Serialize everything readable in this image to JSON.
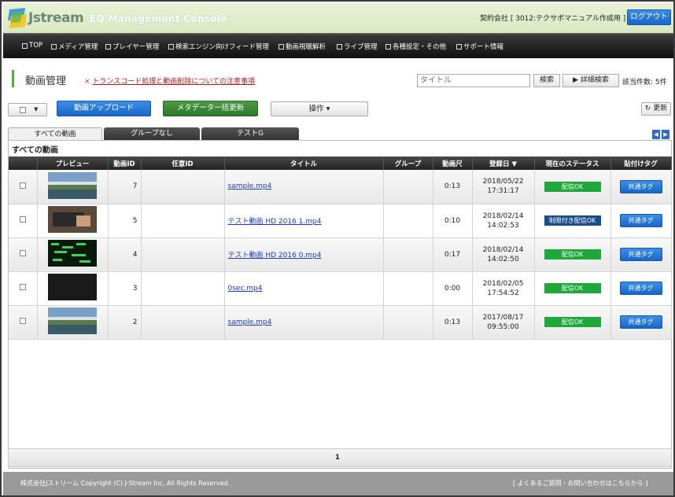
{
  "header": {
    "logo_text": "Jstream",
    "console_title": "EQ Management Console",
    "company": "契約会社 [ 3012:テクサポマニュアル作成用 ]",
    "logout_label": "ログアウト"
  },
  "nav": {
    "items": [
      {
        "label": "TOP"
      },
      {
        "label": "メディア管理"
      },
      {
        "label": "プレイヤー管理"
      },
      {
        "label": "検索エンジン向けフィード管理"
      },
      {
        "label": "動画視聴解析"
      },
      {
        "label": "ライブ管理"
      },
      {
        "label": "各種設定・その他"
      },
      {
        "label": "サポート情報"
      }
    ]
  },
  "page": {
    "title": "動画管理",
    "notice_mark": "×",
    "notice_link": "トランスコード処理と動画削除についての注意事項",
    "search_placeholder": "タイトル",
    "search_button": "検索",
    "advanced_search": "▶ 詳細検索",
    "count": "該当件数: 5件"
  },
  "toolbar": {
    "select_arrow": "▼",
    "upload_label": "動画アップロード",
    "metadata_label": "メタデータ一括更新",
    "operations_label": "操作 ▾",
    "refresh_label": "↻ 更新"
  },
  "tabs": [
    {
      "label": "すべての動画"
    },
    {
      "label": "グループなし"
    },
    {
      "label": "テストG"
    }
  ],
  "tab_arrows": {
    "prev": "◀",
    "next": "▶"
  },
  "list": {
    "title": "すべての動画",
    "columns": [
      "",
      "プレビュー",
      "動画ID",
      "任意ID",
      "タイトル",
      "グループ",
      "動画尺",
      "登録日 ▼",
      "現在のステータス",
      "貼付けタグ"
    ],
    "rows": [
      {
        "id": "7",
        "custom_id": "",
        "title": "sample.mp4",
        "group": "",
        "duration": "0:13",
        "date": "2018/05/22",
        "time": "17:31:17",
        "status": "配信OK",
        "status_kind": "ok",
        "tag": "共通タグ",
        "thumb": "coast"
      },
      {
        "id": "5",
        "custom_id": "",
        "title": "テスト動画 HD 2016 1.mp4",
        "group": "",
        "duration": "0:10",
        "date": "2018/02/14",
        "time": "14:02:53",
        "status": "制限付き配信OK",
        "status_kind": "limited",
        "tag": "共通タグ",
        "thumb": "keyboard"
      },
      {
        "id": "4",
        "custom_id": "",
        "title": "テスト動画 HD 2016 0.mp4",
        "group": "",
        "duration": "0:17",
        "date": "2018/02/14",
        "time": "14:02:50",
        "status": "配信OK",
        "status_kind": "ok",
        "tag": "共通タグ",
        "thumb": "matrix"
      },
      {
        "id": "3",
        "custom_id": "",
        "title": "0sec.mp4",
        "group": "",
        "duration": "0:00",
        "date": "2018/02/05",
        "time": "17:54:52",
        "status": "配信OK",
        "status_kind": "ok",
        "tag": "共通タグ",
        "thumb": "black"
      },
      {
        "id": "2",
        "custom_id": "",
        "title": "sample.mp4",
        "group": "",
        "duration": "0:13",
        "date": "2017/08/17",
        "time": "09:55:00",
        "status": "配信OK",
        "status_kind": "ok",
        "tag": "共通タグ",
        "thumb": "coast"
      }
    ]
  },
  "pagination": {
    "current": "1"
  },
  "footer": {
    "copyright": "株式会社Jストリーム  Copyright (C) J-Stream Inc. All Rights Reserved.",
    "help_link": "[ よくあるご質問・お問い合わせはこちらから ]"
  },
  "colors": {
    "header_bg": "#dcebc6",
    "nav_bg": "#1a1a1a",
    "primary_button": "#1f72d8",
    "green_button": "#2c7a2a",
    "status_ok": "#1fa83a",
    "status_limited": "#1d4c8c",
    "accent_bar": "#4fae3a",
    "notice": "#d9302a"
  }
}
